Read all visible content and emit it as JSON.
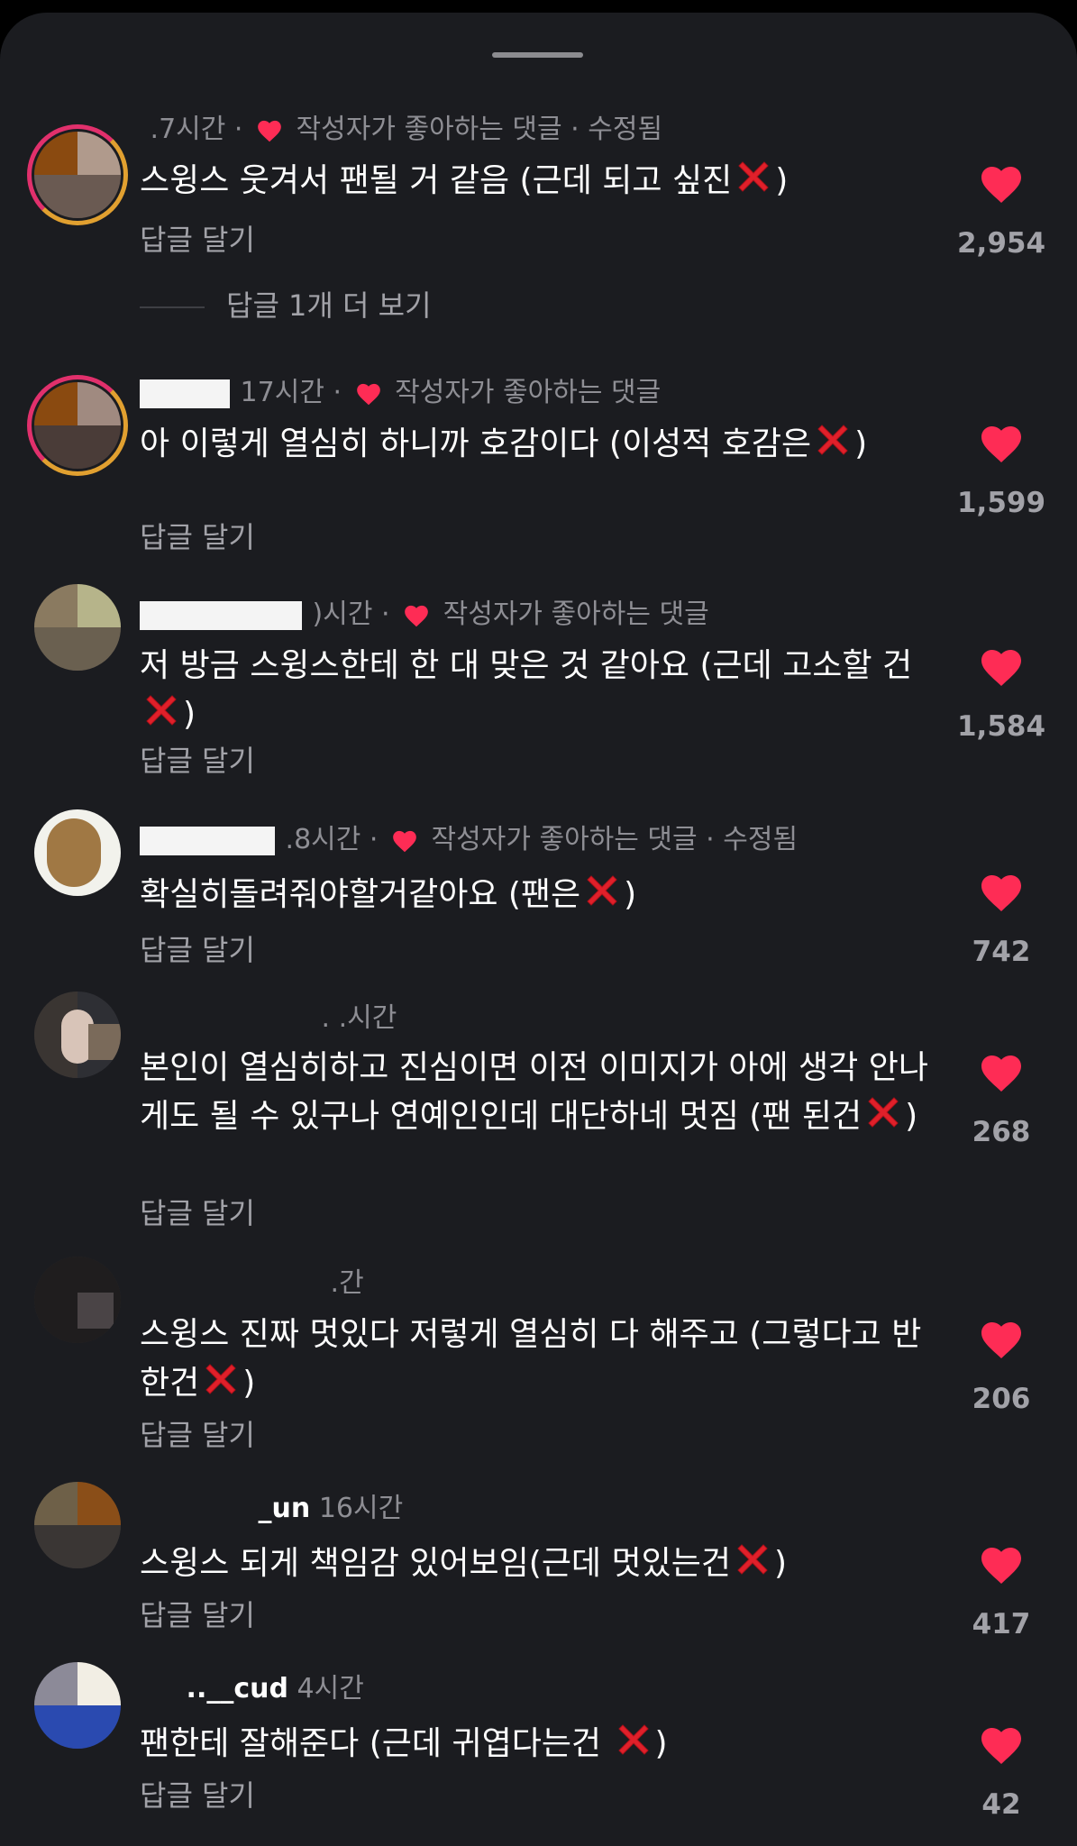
{
  "author_liked_label": "작성자가 좋아하는 댓글",
  "edited_label": "수정됨",
  "reply_label": "답글 달기",
  "view_more_replies": "답글 1개 더 보기",
  "colors": {
    "background": "#1b1c20",
    "like_red": "#fe2c55",
    "text_primary": "#ffffff",
    "text_secondary": "#8e8e94"
  },
  "icons": {
    "heart": "heart-icon",
    "cross": "red-x-emoji"
  },
  "comments": [
    {
      "time": ".7시간",
      "author_liked": true,
      "edited": true,
      "text": "스윙스 웃겨서 팬될 거 같음 (근데 되고 싶진",
      "text_after": ")",
      "likes": "2,954"
    },
    {
      "time": "17시간",
      "author_liked": true,
      "edited": false,
      "text": "아 이렇게 열심히 하니까 호감이다 (이성적 호감은",
      "text_after": ")",
      "likes": "1,599"
    },
    {
      "time": ")시간",
      "author_liked": true,
      "edited": false,
      "text": "저 방금 스윙스한테 한 대 맞은 것 같아요 (근데 고소할 건",
      "text_after": ")",
      "likes": "1,584"
    },
    {
      "time": ".8시간",
      "author_liked": true,
      "edited": true,
      "text": "확실히돌려줘야할거같아요 (팬은",
      "text_after": ")",
      "likes": "742"
    },
    {
      "time": ". .시간",
      "author_liked": false,
      "edited": false,
      "text": "본인이 열심히하고 진심이면 이전 이미지가 아에 생각 안나게도 될 수 있구나 연예인인데 대단하네 멋짐 (팬 된건",
      "text_after": ")",
      "likes": "268"
    },
    {
      "time": ".간",
      "author_liked": false,
      "edited": false,
      "text": "스윙스 진짜 멋있다 저렇게 열심히 다 해주고 (그렇다고 반한건",
      "text_after": ")",
      "likes": "206"
    },
    {
      "username": "_un",
      "time": "16시간",
      "author_liked": false,
      "edited": false,
      "text": "스윙스 되게 책임감 있어보임(근데 멋있는건",
      "text_after": ")",
      "likes": "417"
    },
    {
      "username": "..__cud",
      "time": "4시간",
      "author_liked": false,
      "edited": false,
      "text": "팬한테 잘해준다 (근데 귀엽다는건 ",
      "text_after": ")",
      "likes": "42"
    }
  ]
}
